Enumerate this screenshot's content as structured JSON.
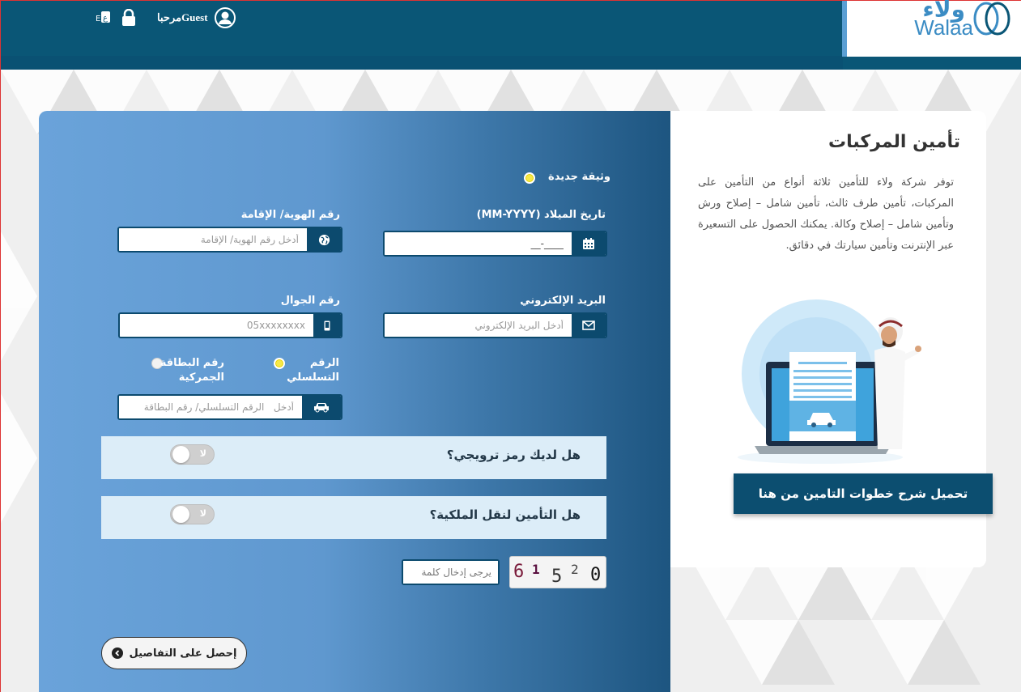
{
  "header": {
    "logo_ar": "ولاء",
    "logo_en": "Walaa",
    "lang_label": "ع",
    "greeting": "مرحباGuest",
    "icons": [
      "language-icon",
      "lock-icon",
      "user-icon"
    ]
  },
  "form": {
    "policy_type_label": "وثيقة جديدة",
    "dob_label": "تاريخ الميلاد (MM-YYYY)",
    "dob_value": "__-____",
    "id_label": "رقم الهوية/ الإقامة",
    "id_placeholder": "أدخل رقم الهوية/ الإقامة",
    "email_label": "البريد الإلكتروني",
    "email_placeholder": "أدخل البريد الإلكتروني",
    "mobile_label": "رقم الجوال",
    "mobile_placeholder": "05xxxxxxxx",
    "serial_option_label": "الرقم التسلسلي",
    "customs_option_label": "رقم البطاقة الجمركية",
    "vehicle_placeholder": "أدخل   الرقم التسلسلي/ رقم البطاقة",
    "promo_question": "هل لديك رمز ترويجي؟",
    "promo_toggle_label": "لا",
    "transfer_question": "هل التأمين لنقل الملكية؟",
    "transfer_toggle_label": "لا",
    "captcha_digits": [
      "6",
      "1",
      "5",
      "2",
      "0"
    ],
    "captcha_placeholder": "يرجى إدخال كلمة",
    "submit_label": "إحصل على التفاصيل"
  },
  "info": {
    "title": "تأمين المركبات",
    "body": "توفر شركة ولاء للتأمين ثلاثة أنواع من التأمين على المركبات، تأمين طرف ثالث، تأمين شامل – إصلاح ورش وتأمين شامل – إصلاح وكالة. يمكنك الحصول على التسعيرة عبر الإنترنت وتأمين سيارتك في دقائق.",
    "download_label": "تحميل شرح خطوات التامين من هنا"
  },
  "colors": {
    "header": "#0a5676",
    "accent": "#0c4a6e",
    "form_gradient_start": "#6aa3da",
    "form_gradient_end": "#1d5580",
    "toggle_row_bg": "#dcedf8"
  }
}
